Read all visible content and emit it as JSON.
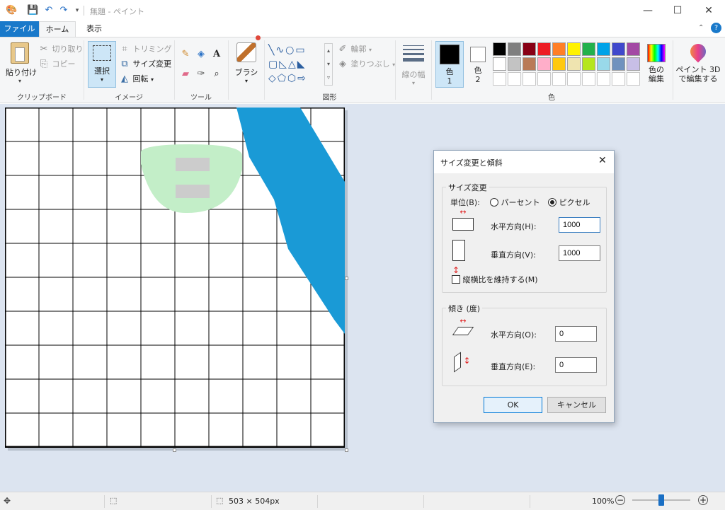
{
  "window": {
    "title": "無題 - ペイント",
    "minimize": "—",
    "maximize": "☐",
    "close": "✕"
  },
  "tabs": {
    "file": "ファイル",
    "home": "ホーム",
    "view": "表示"
  },
  "clipboard": {
    "paste": "貼り付け",
    "cut": "切り取り",
    "copy": "コピー",
    "group": "クリップボード"
  },
  "image": {
    "select": "選択",
    "crop": "トリミング",
    "resize": "サイズ変更",
    "rotate": "回転",
    "group": "イメージ"
  },
  "tools": {
    "group": "ツール"
  },
  "brushes": {
    "label": "ブラシ"
  },
  "shapes": {
    "outline": "輪郭",
    "fill": "塗りつぶし",
    "group": "図形"
  },
  "size": {
    "label": "線の幅"
  },
  "colors": {
    "color1": "色",
    "color1_num": "1",
    "color2": "色",
    "color2_num": "2",
    "edit": [
      "色の",
      "編集"
    ],
    "group": "色",
    "color1_value": "#000000",
    "color2_value": "#ffffff",
    "palette": [
      [
        "#000000",
        "#7f7f7f",
        "#880015",
        "#ed1c24",
        "#ff7f27",
        "#fff200",
        "#22b14c",
        "#00a2e8",
        "#3f48cc",
        "#a349a4"
      ],
      [
        "#ffffff",
        "#c3c3c3",
        "#b97a57",
        "#ffaec9",
        "#ffc90e",
        "#efe4b0",
        "#b5e61d",
        "#99d9ea",
        "#7092be",
        "#c8bfe7"
      ],
      [
        "#ffffff",
        "#ffffff",
        "#ffffff",
        "#ffffff",
        "#ffffff",
        "#ffffff",
        "#ffffff",
        "#ffffff",
        "#ffffff",
        "#ffffff"
      ]
    ]
  },
  "paint3d": [
    "ペイント 3D",
    "で編集する"
  ],
  "canvas_art": {
    "grid_lines": "#000000",
    "band_color": "#1a9ad6",
    "blob_color": "#c3eec8",
    "rect_color": "#cccccc"
  },
  "dialog": {
    "title": "サイズ変更と傾斜",
    "resize_group": "サイズ変更",
    "unit_label": "単位(B):",
    "unit_percent": "パーセント",
    "unit_pixel": "ピクセル",
    "unit_selected": "pixel",
    "horizontal_label": "水平方向(H):",
    "horizontal_value": "1000",
    "vertical_label": "垂直方向(V):",
    "vertical_value": "1000",
    "aspect_label": "縦横比を維持する(M)",
    "aspect_checked": false,
    "skew_group": "傾き (度)",
    "skew_h_label": "水平方向(O):",
    "skew_h_value": "0",
    "skew_v_label": "垂直方向(E):",
    "skew_v_value": "0",
    "ok": "OK",
    "cancel": "キャンセル"
  },
  "status": {
    "image_size": "503 × 504px",
    "zoom": "100%",
    "zoom_level": 0.5
  }
}
